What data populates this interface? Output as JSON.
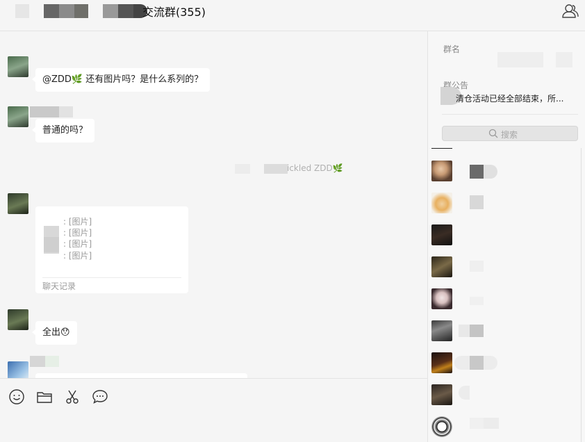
{
  "window": {
    "title": "交流群(355)"
  },
  "messages": [
    {
      "text": "@ZDD🌿 还有图片吗？是什么系列的？"
    },
    {
      "text": "普通的吗？"
    },
    {
      "text": "全出😯"
    }
  ],
  "system_notice": {
    "text": "ickled ZDD🌿"
  },
  "chat_record": {
    "lines": [
      ": [图片]",
      ": [图片]",
      ": [图片]",
      ": [图片]"
    ],
    "footer": "聊天记录"
  },
  "panel": {
    "group_name_label": "群名",
    "notice_label": "群公告",
    "notice_text": "清仓活动已经全部结束，所...",
    "search_placeholder": "搜索"
  },
  "colors": {
    "bubble": "#ffffff",
    "chat_bg": "#f5f5f5",
    "accent_leaf": "#6ba04a"
  }
}
